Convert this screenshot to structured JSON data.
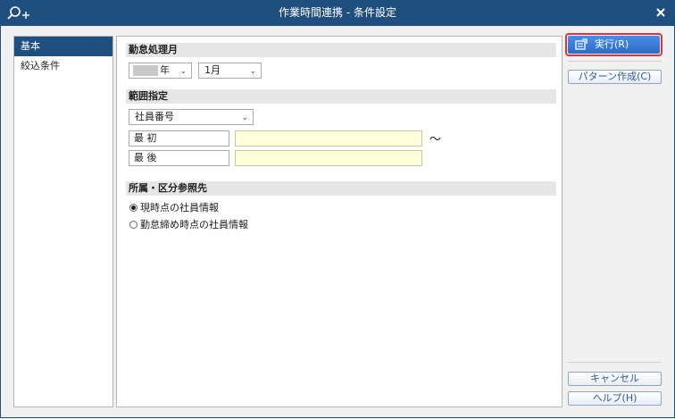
{
  "window": {
    "title": "作業時間連携 - 条件設定",
    "close_label": "×"
  },
  "nav": {
    "items": [
      {
        "label": "基本",
        "active": true
      },
      {
        "label": "絞込条件",
        "active": false
      }
    ]
  },
  "sections": {
    "month": {
      "header": "勤怠処理月",
      "year_suffix": "年",
      "month_value": "1月"
    },
    "range": {
      "header": "範囲指定",
      "field_select": "社員番号",
      "first_label": "最 初",
      "last_label": "最 後",
      "first_value": "",
      "last_value": "",
      "tilde": "～"
    },
    "dept": {
      "header": "所属・区分参照先",
      "options": [
        {
          "label": "現時点の社員情報",
          "checked": true
        },
        {
          "label": "勤怠締め時点の社員情報",
          "checked": false
        }
      ]
    }
  },
  "actions": {
    "execute": "実行(R)",
    "pattern": "パターン作成(C)",
    "cancel": "キャンセル",
    "help": "ヘルプ(H)"
  },
  "colors": {
    "titlebar": "#1f4f7f",
    "accent": "#2b6bc8",
    "highlight_border": "#e0343b",
    "input_bg": "#fefed8"
  },
  "icons": [
    "search-plus-icon",
    "close-icon",
    "chevron-down-icon",
    "execute-icon"
  ]
}
